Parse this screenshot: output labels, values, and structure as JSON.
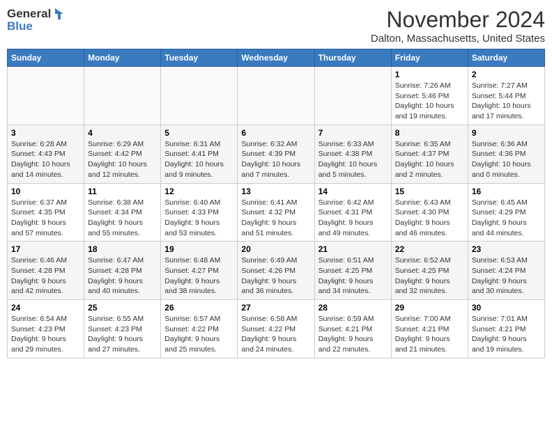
{
  "header": {
    "logo_general": "General",
    "logo_blue": "Blue",
    "month_title": "November 2024",
    "location": "Dalton, Massachusetts, United States"
  },
  "days_of_week": [
    "Sunday",
    "Monday",
    "Tuesday",
    "Wednesday",
    "Thursday",
    "Friday",
    "Saturday"
  ],
  "weeks": [
    [
      {
        "day": "",
        "info": ""
      },
      {
        "day": "",
        "info": ""
      },
      {
        "day": "",
        "info": ""
      },
      {
        "day": "",
        "info": ""
      },
      {
        "day": "",
        "info": ""
      },
      {
        "day": "1",
        "info": "Sunrise: 7:26 AM\nSunset: 5:46 PM\nDaylight: 10 hours\nand 19 minutes."
      },
      {
        "day": "2",
        "info": "Sunrise: 7:27 AM\nSunset: 5:44 PM\nDaylight: 10 hours\nand 17 minutes."
      }
    ],
    [
      {
        "day": "3",
        "info": "Sunrise: 6:28 AM\nSunset: 4:43 PM\nDaylight: 10 hours\nand 14 minutes."
      },
      {
        "day": "4",
        "info": "Sunrise: 6:29 AM\nSunset: 4:42 PM\nDaylight: 10 hours\nand 12 minutes."
      },
      {
        "day": "5",
        "info": "Sunrise: 6:31 AM\nSunset: 4:41 PM\nDaylight: 10 hours\nand 9 minutes."
      },
      {
        "day": "6",
        "info": "Sunrise: 6:32 AM\nSunset: 4:39 PM\nDaylight: 10 hours\nand 7 minutes."
      },
      {
        "day": "7",
        "info": "Sunrise: 6:33 AM\nSunset: 4:38 PM\nDaylight: 10 hours\nand 5 minutes."
      },
      {
        "day": "8",
        "info": "Sunrise: 6:35 AM\nSunset: 4:37 PM\nDaylight: 10 hours\nand 2 minutes."
      },
      {
        "day": "9",
        "info": "Sunrise: 6:36 AM\nSunset: 4:36 PM\nDaylight: 10 hours\nand 0 minutes."
      }
    ],
    [
      {
        "day": "10",
        "info": "Sunrise: 6:37 AM\nSunset: 4:35 PM\nDaylight: 9 hours\nand 57 minutes."
      },
      {
        "day": "11",
        "info": "Sunrise: 6:38 AM\nSunset: 4:34 PM\nDaylight: 9 hours\nand 55 minutes."
      },
      {
        "day": "12",
        "info": "Sunrise: 6:40 AM\nSunset: 4:33 PM\nDaylight: 9 hours\nand 53 minutes."
      },
      {
        "day": "13",
        "info": "Sunrise: 6:41 AM\nSunset: 4:32 PM\nDaylight: 9 hours\nand 51 minutes."
      },
      {
        "day": "14",
        "info": "Sunrise: 6:42 AM\nSunset: 4:31 PM\nDaylight: 9 hours\nand 49 minutes."
      },
      {
        "day": "15",
        "info": "Sunrise: 6:43 AM\nSunset: 4:30 PM\nDaylight: 9 hours\nand 46 minutes."
      },
      {
        "day": "16",
        "info": "Sunrise: 6:45 AM\nSunset: 4:29 PM\nDaylight: 9 hours\nand 44 minutes."
      }
    ],
    [
      {
        "day": "17",
        "info": "Sunrise: 6:46 AM\nSunset: 4:28 PM\nDaylight: 9 hours\nand 42 minutes."
      },
      {
        "day": "18",
        "info": "Sunrise: 6:47 AM\nSunset: 4:28 PM\nDaylight: 9 hours\nand 40 minutes."
      },
      {
        "day": "19",
        "info": "Sunrise: 6:48 AM\nSunset: 4:27 PM\nDaylight: 9 hours\nand 38 minutes."
      },
      {
        "day": "20",
        "info": "Sunrise: 6:49 AM\nSunset: 4:26 PM\nDaylight: 9 hours\nand 36 minutes."
      },
      {
        "day": "21",
        "info": "Sunrise: 6:51 AM\nSunset: 4:25 PM\nDaylight: 9 hours\nand 34 minutes."
      },
      {
        "day": "22",
        "info": "Sunrise: 6:52 AM\nSunset: 4:25 PM\nDaylight: 9 hours\nand 32 minutes."
      },
      {
        "day": "23",
        "info": "Sunrise: 6:53 AM\nSunset: 4:24 PM\nDaylight: 9 hours\nand 30 minutes."
      }
    ],
    [
      {
        "day": "24",
        "info": "Sunrise: 6:54 AM\nSunset: 4:23 PM\nDaylight: 9 hours\nand 29 minutes."
      },
      {
        "day": "25",
        "info": "Sunrise: 6:55 AM\nSunset: 4:23 PM\nDaylight: 9 hours\nand 27 minutes."
      },
      {
        "day": "26",
        "info": "Sunrise: 6:57 AM\nSunset: 4:22 PM\nDaylight: 9 hours\nand 25 minutes."
      },
      {
        "day": "27",
        "info": "Sunrise: 6:58 AM\nSunset: 4:22 PM\nDaylight: 9 hours\nand 24 minutes."
      },
      {
        "day": "28",
        "info": "Sunrise: 6:59 AM\nSunset: 4:21 PM\nDaylight: 9 hours\nand 22 minutes."
      },
      {
        "day": "29",
        "info": "Sunrise: 7:00 AM\nSunset: 4:21 PM\nDaylight: 9 hours\nand 21 minutes."
      },
      {
        "day": "30",
        "info": "Sunrise: 7:01 AM\nSunset: 4:21 PM\nDaylight: 9 hours\nand 19 minutes."
      }
    ]
  ]
}
